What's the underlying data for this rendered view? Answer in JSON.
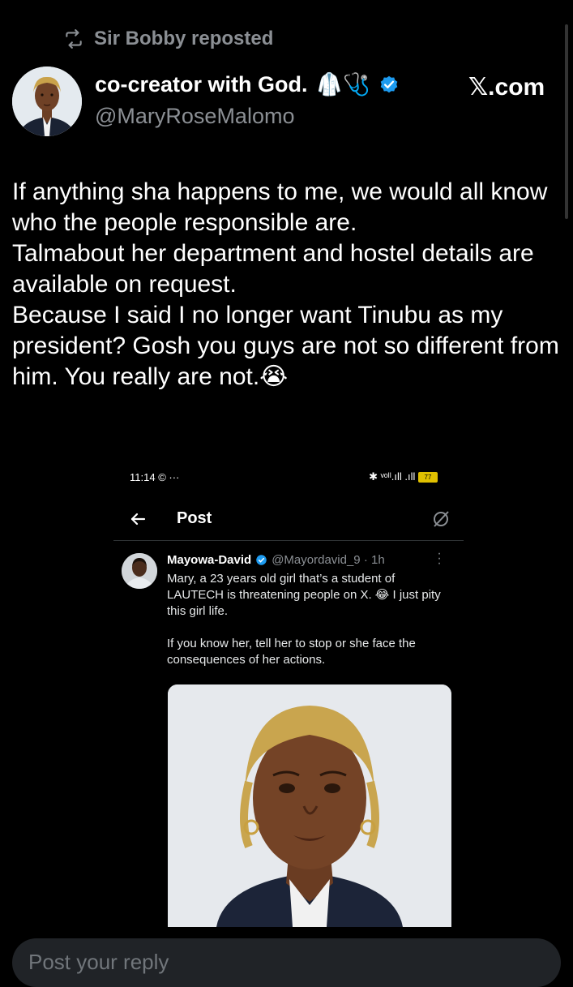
{
  "repost": {
    "label": "Sir Bobby reposted",
    "icon": "repost-icon"
  },
  "author": {
    "name": "co-creator with God.",
    "name_emoji": "🥼🩺",
    "handle": "@MaryRoseMalomo",
    "verified": true,
    "verified_color": "#1d9bf0"
  },
  "source_label": "𝕏.com",
  "post": {
    "lines": [
      "If anything sha happens to me, we would all know who the people responsible are.",
      "Talmabout her department and hostel details are available on request.",
      "Because I said I no longer want Tinubu as my president? Gosh you guys are not so different from him. You really are not.😭"
    ]
  },
  "embedded": {
    "status_time": "11:14",
    "status_extra": "© ···",
    "status_right": "✱ ᵛᵒˡˡ.ıll .ıll",
    "battery": "77",
    "header_title": "Post",
    "reply": {
      "name": "Mayowa-David",
      "handle": "@Mayordavid_9 · 1h",
      "paragraph1": "Mary, a 23 years old girl that’s a student of LAUTECH is threatening people on X. 😂 I just pity this girl life.",
      "paragraph2": "If you know her, tell her to stop or she face the consequences of her actions."
    }
  },
  "reply_box": {
    "placeholder": "Post your reply"
  }
}
